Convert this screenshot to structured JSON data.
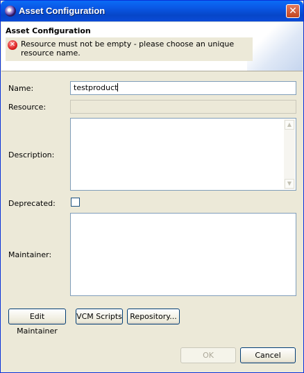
{
  "window": {
    "title": "Asset Configuration",
    "close_glyph": "✕"
  },
  "banner": {
    "heading": "Asset Configuration",
    "error_message": "Resource must not be empty - please choose an unique resource name.",
    "error_icon": "error-icon"
  },
  "form": {
    "name_label": "Name:",
    "name_value": "testproduct",
    "resource_label": "Resource:",
    "resource_value": "",
    "description_label": "Description:",
    "description_value": "",
    "deprecated_label": "Deprecated:",
    "deprecated_checked": false,
    "maintainer_label": "Maintainer:",
    "maintainer_value": ""
  },
  "buttons": {
    "edit_maintainer": "Edit Maintainer",
    "vcm_scripts": "VCM Scripts",
    "repository": "Repository...",
    "ok": "OK",
    "cancel": "Cancel"
  },
  "colors": {
    "titlebar": "#0a5ae8",
    "dialog_bg": "#ece9d8",
    "field_border": "#7f9db9"
  }
}
